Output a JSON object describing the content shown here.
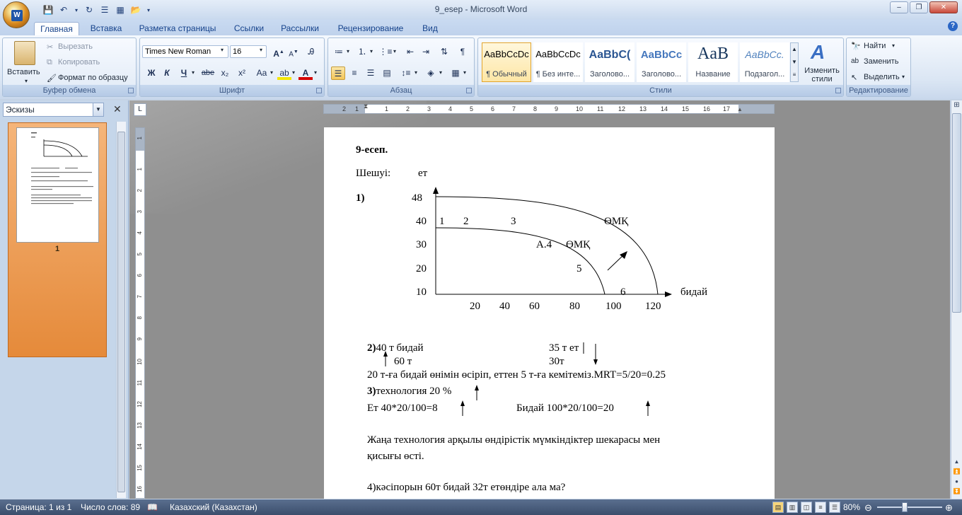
{
  "window": {
    "title": "9_esep - Microsoft Word",
    "min": "–",
    "max": "❐",
    "close": "✕"
  },
  "tabs": [
    "Главная",
    "Вставка",
    "Разметка страницы",
    "Ссылки",
    "Рассылки",
    "Рецензирование",
    "Вид"
  ],
  "ribbon": {
    "clipboard": {
      "title": "Буфер обмена",
      "paste": "Вставить",
      "cut": "Вырезать",
      "copy": "Копировать",
      "format_painter": "Формат по образцу"
    },
    "font": {
      "title": "Шрифт",
      "name": "Times New Roman",
      "size": "16",
      "bold": "Ж",
      "italic": "К",
      "underline": "Ч",
      "strike": "abe",
      "sub": "x₂",
      "sup": "x²",
      "case": "Aa"
    },
    "paragraph": {
      "title": "Абзац"
    },
    "styles": {
      "title": "Стили",
      "items": [
        {
          "preview": "AaBbCcDc",
          "name": "¶ Обычный"
        },
        {
          "preview": "AaBbCcDc",
          "name": "¶ Без инте..."
        },
        {
          "preview": "AaBbC(",
          "name": "Заголово..."
        },
        {
          "preview": "AaBbCc",
          "name": "Заголово..."
        },
        {
          "preview": "AaB",
          "name": "Название"
        },
        {
          "preview": "AaBbCc.",
          "name": "Подзагол..."
        }
      ],
      "change": "Изменить стили"
    },
    "editing": {
      "title": "Редактирование",
      "find": "Найти",
      "replace": "Заменить",
      "select": "Выделить"
    }
  },
  "nav": {
    "dropdown": "Эскизы",
    "page_num": "1"
  },
  "ruler": {
    "h": [
      "2",
      "1",
      "1",
      "2",
      "3",
      "4",
      "5",
      "6",
      "7",
      "8",
      "9",
      "10",
      "11",
      "12",
      "13",
      "14",
      "15",
      "16",
      "17"
    ],
    "v": [
      "1",
      "1",
      "2",
      "3",
      "4",
      "5",
      "6",
      "7",
      "8",
      "9",
      "10",
      "11",
      "12",
      "13",
      "14",
      "15",
      "16"
    ]
  },
  "doc": {
    "heading": "9-есеп.",
    "solution": "Шешуі:",
    "y_axis_label": "ет",
    "item1": "1)",
    "y_ticks": [
      "48",
      "40",
      "30",
      "20",
      "10"
    ],
    "x_ticks": [
      "20",
      "40",
      "60",
      "80",
      "100",
      "120"
    ],
    "x_axis_label": "бидай",
    "pt1": "1",
    "pt2": "2",
    "pt3": "3",
    "ppf_outer": "ӨМҚ",
    "a4": "А.4",
    "ppf_inner": "ӨМҚ",
    "pt5": "5",
    "pt6": "6",
    "line2a_num": "2)",
    "line2a": "40 т бидай",
    "line2a_right": "35 т ет",
    "line2b": "60 т",
    "line2b_right": "30т",
    "line3": "20 т-ға бидай өнімін өсіріп, еттен 5 т-ға кемітеміз.MRT=5/20=0.25",
    "line4_num": "3)",
    "line4": "технология 20 %",
    "line5": "Ет  40*20/100=8",
    "line5_right": "Бидай 100*20/100=20",
    "line6": "Жаңа технология арқылы өндірістік мүмкіндіктер шекарасы мен",
    "line7": "қисығы өсті.",
    "line8": "4)кәсіпорын 60т бидай 32т етөндіре ала ма?"
  },
  "status": {
    "page": "Страница: 1 из 1",
    "words": "Число слов: 89",
    "lang": "Казахский (Казахстан)",
    "zoom": "80%"
  }
}
